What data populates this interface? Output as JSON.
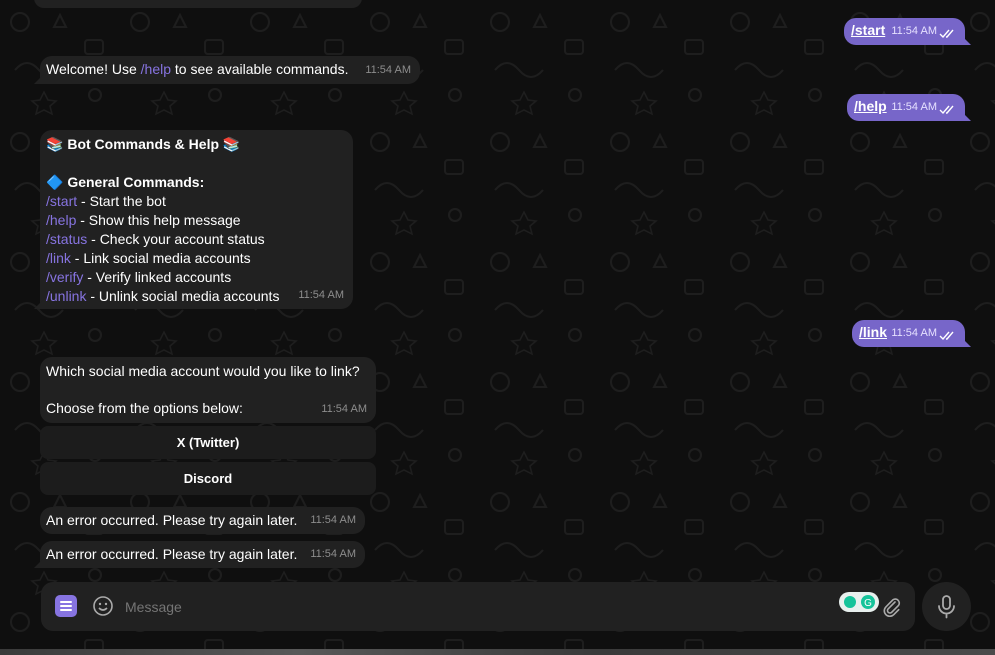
{
  "colors": {
    "accent": "#8774e1",
    "outgoing_bubble": "#7766c9",
    "incoming_bubble": "#212121",
    "background": "#0f0f0f"
  },
  "messages": {
    "out_start": {
      "text": "/start",
      "time": "11:54 AM"
    },
    "welcome": {
      "prefix": "Welcome! Use ",
      "cmd": "/help",
      "suffix": " to see available commands.",
      "time": "11:54 AM"
    },
    "out_help": {
      "text": "/help",
      "time": "11:54 AM"
    },
    "help": {
      "title_emoji": "📚",
      "title": "Bot Commands & Help",
      "section_emoji": "🔷",
      "section": "General Commands:",
      "commands": [
        {
          "cmd": "/start",
          "desc": " - Start the bot"
        },
        {
          "cmd": "/help",
          "desc": " - Show this help message"
        },
        {
          "cmd": "/status",
          "desc": " - Check your account status"
        },
        {
          "cmd": "/link",
          "desc": " - Link social media accounts"
        },
        {
          "cmd": "/verify",
          "desc": " - Verify linked accounts"
        },
        {
          "cmd": "/unlink",
          "desc": " - Unlink social media accounts"
        }
      ],
      "time": "11:54 AM"
    },
    "out_link": {
      "text": "/link",
      "time": "11:54 AM"
    },
    "link_prompt": {
      "line1": "Which social media account would you like to link?",
      "line2": "Choose from the options below:",
      "time": "11:54 AM",
      "buttons": [
        "X (Twitter)",
        "Discord"
      ]
    },
    "error1": {
      "text": "An error occurred. Please try again later.",
      "time": "11:54 AM"
    },
    "error2": {
      "text": "An error occurred. Please try again later.",
      "time": "11:54 AM"
    }
  },
  "composer": {
    "placeholder": "Message",
    "menu_icon": "bot-menu-icon",
    "emoji_icon": "emoji-icon",
    "attach_icon": "paperclip-icon",
    "mic_icon": "microphone-icon"
  }
}
